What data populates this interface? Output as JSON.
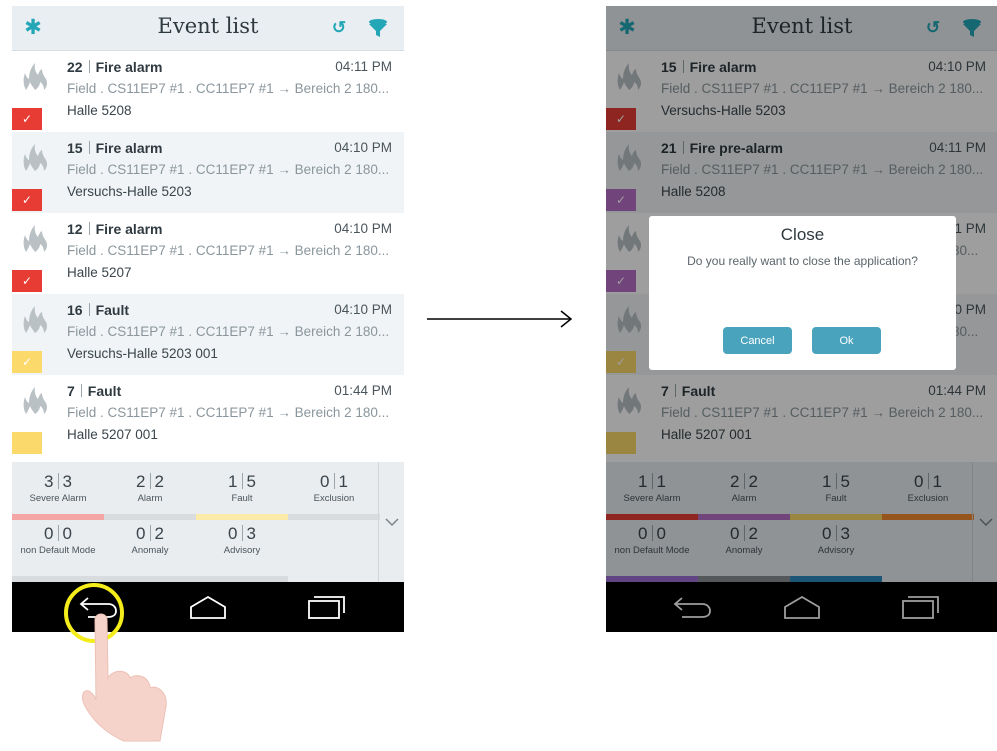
{
  "title": "Event list",
  "left_events": [
    {
      "id": "22",
      "type": "Fire alarm",
      "time": "04:11 PM",
      "path": "Field . CS11EP7 #1 . CC11EP7 #1 → Bereich 2 180...",
      "location": "Halle 5208",
      "status_color": "#e63c34",
      "check": "✓"
    },
    {
      "id": "15",
      "type": "Fire alarm",
      "time": "04:10 PM",
      "path": "Field . CS11EP7 #1 . CC11EP7 #1 → Bereich 2 180...",
      "location": "Versuchs-Halle 5203",
      "status_color": "#e63c34",
      "check": "✓"
    },
    {
      "id": "12",
      "type": "Fire alarm",
      "time": "04:10 PM",
      "path": "Field . CS11EP7 #1 . CC11EP7 #1 → Bereich 2 180...",
      "location": "Halle 5207",
      "status_color": "#e63c34",
      "check": "✓"
    },
    {
      "id": "16",
      "type": "Fault",
      "time": "04:10 PM",
      "path": "Field . CS11EP7 #1 . CC11EP7 #1 → Bereich 2 180...",
      "location": "Versuchs-Halle 5203 001",
      "status_color": "#fbd96a",
      "check": "✓"
    },
    {
      "id": "7",
      "type": "Fault",
      "time": "01:44 PM",
      "path": "Field . CS11EP7 #1 . CC11EP7 #1 → Bereich 2 180...",
      "location": "Halle 5207 001",
      "status_color": "#fbd96a",
      "check": ""
    }
  ],
  "right_events": [
    {
      "id": "15",
      "type": "Fire alarm",
      "time": "04:10 PM",
      "path": "Field . CS11EP7 #1 . CC11EP7 #1 → Bereich 2 180...",
      "location": "Versuchs-Halle 5203",
      "status_color": "#e63c34",
      "check": "✓"
    },
    {
      "id": "21",
      "type": "Fire pre-alarm",
      "time": "04:11 PM",
      "path": "Field . CS11EP7 #1 . CC11EP7 #1 → Bereich 2 180...",
      "location": "Halle 5208",
      "status_color": "#b86fc9",
      "check": "✓"
    },
    {
      "time": "1 PM",
      "path": "80...",
      "status_color": "#b86fc9",
      "check": "✓"
    },
    {
      "time": "0 PM",
      "path": "80...",
      "status_color": "#fbd96a",
      "check": "✓"
    },
    {
      "id": "7",
      "type": "Fault",
      "time": "01:44 PM",
      "path": "Field . CS11EP7 #1 . CC11EP7 #1 → Bereich 2 180...",
      "location": "Halle 5207 001",
      "status_color": "#fbd96a",
      "check": ""
    }
  ],
  "counters_left": [
    {
      "a": "3",
      "b": "3",
      "label": "Severe Alarm",
      "color": "#f4a6a6"
    },
    {
      "a": "2",
      "b": "2",
      "label": "Alarm",
      "color": "#d8dcdf"
    },
    {
      "a": "1",
      "b": "5",
      "label": "Fault",
      "color": "#fbeaa8"
    },
    {
      "a": "0",
      "b": "1",
      "label": "Exclusion",
      "color": "#d8dcdf"
    },
    {
      "a": "0",
      "b": "0",
      "label": "non Default Mode",
      "color": "#d8dcdf"
    },
    {
      "a": "0",
      "b": "2",
      "label": "Anomaly",
      "color": "#d8dcdf"
    },
    {
      "a": "0",
      "b": "3",
      "label": "Advisory",
      "color": "#d8dcdf"
    }
  ],
  "counters_right": [
    {
      "a": "1",
      "b": "1",
      "label": "Severe Alarm",
      "color": "#e63c34"
    },
    {
      "a": "2",
      "b": "2",
      "label": "Alarm",
      "color": "#b86fc9"
    },
    {
      "a": "1",
      "b": "5",
      "label": "Fault",
      "color": "#fbd96a"
    },
    {
      "a": "0",
      "b": "1",
      "label": "Exclusion",
      "color": "#f28a2e"
    },
    {
      "a": "0",
      "b": "0",
      "label": "non Default Mode",
      "color": "#9b6fd6"
    },
    {
      "a": "0",
      "b": "2",
      "label": "Anomaly",
      "color": "#8a8f93"
    },
    {
      "a": "0",
      "b": "3",
      "label": "Advisory",
      "color": "#2e8bc0"
    }
  ],
  "dialog": {
    "title": "Close",
    "message": "Do you really want to close the application?",
    "cancel": "Cancel",
    "ok": "Ok"
  },
  "icons": [
    "gear-icon",
    "refresh-icon",
    "filter-icon",
    "fire-icon",
    "back-icon",
    "home-icon",
    "recents-icon",
    "chevron-down-icon",
    "arrow-icon",
    "hand-icon"
  ],
  "colors": {
    "accent": "#23a6b6",
    "button": "#4aa3bd",
    "highlight": "#f5ec1c",
    "navbar": "#000000"
  }
}
